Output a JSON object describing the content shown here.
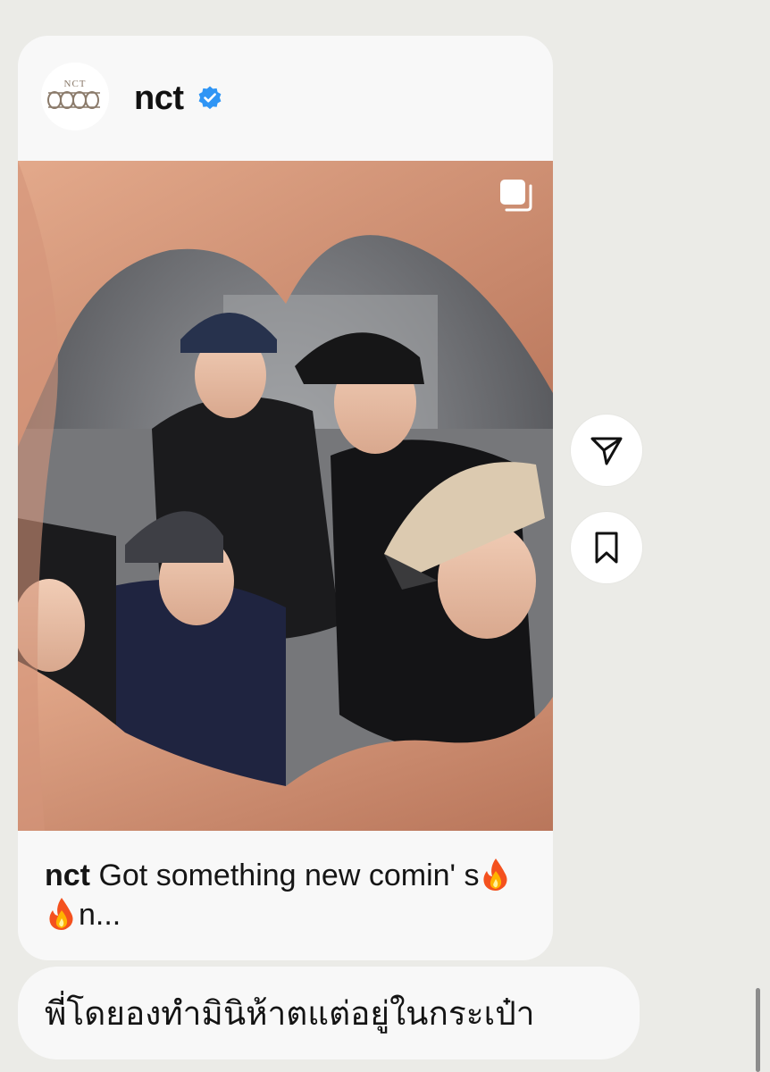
{
  "post": {
    "username": "nct",
    "avatar_logo_text": "NCT 2023",
    "caption_user": "nct",
    "caption_text_part1": "Got something new comin' s",
    "caption_text_part2": "n...",
    "caption_emoji": "fire-emoji",
    "media_description_icon": "photo-carousel-icon",
    "verified": true
  },
  "actions": {
    "share_icon": "paper-plane-icon",
    "save_icon": "bookmark-icon"
  },
  "message": {
    "text": "พี่โดยองทำมินิห้าตแต่อยู่ในกระเป๋า"
  },
  "colors": {
    "background": "#ebebe7",
    "bubble": "#f8f8f8",
    "verified_blue": "#2f95f5",
    "text": "#141414"
  }
}
